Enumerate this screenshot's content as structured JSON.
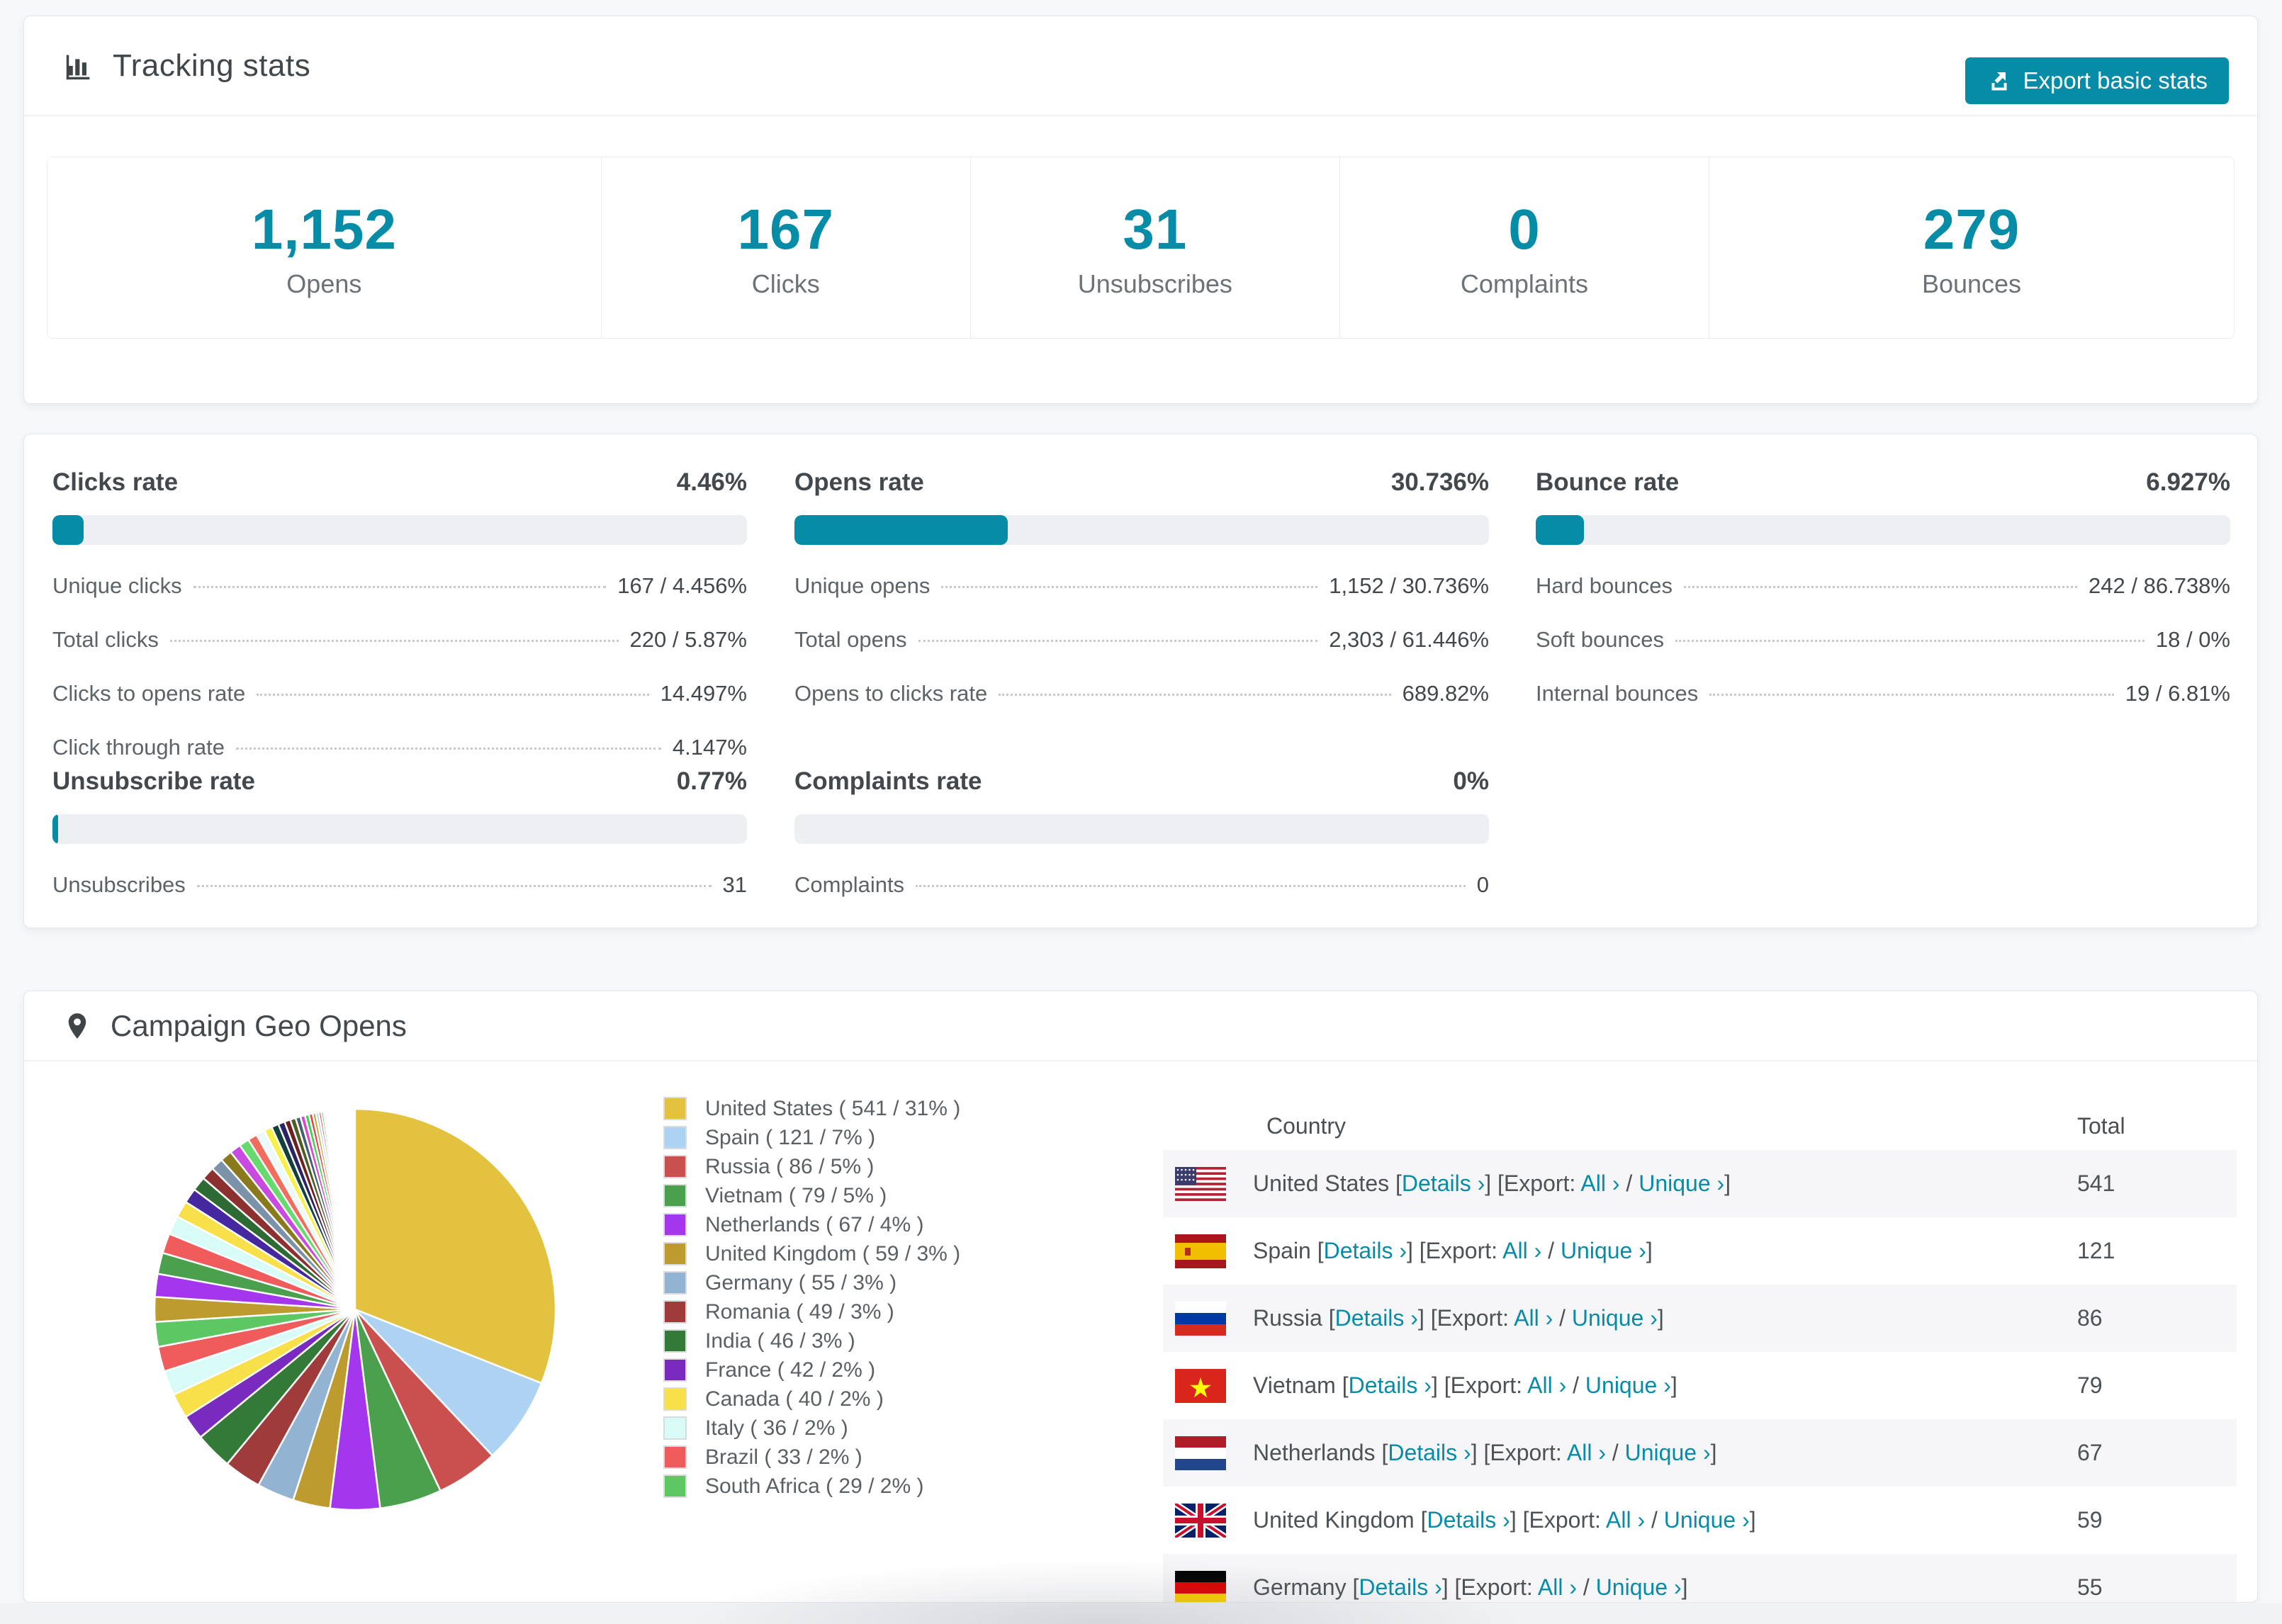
{
  "page": {
    "accent": "#078ca7"
  },
  "tracking": {
    "title": "Tracking stats",
    "export_button": "Export basic stats",
    "summary": [
      {
        "value": "1,152",
        "label": "Opens"
      },
      {
        "value": "167",
        "label": "Clicks"
      },
      {
        "value": "31",
        "label": "Unsubscribes"
      },
      {
        "value": "0",
        "label": "Complaints"
      },
      {
        "value": "279",
        "label": "Bounces"
      }
    ]
  },
  "rates": {
    "clicks": {
      "title": "Clicks rate",
      "value": "4.46%",
      "fill_pct": 4.46,
      "rows": [
        {
          "label": "Unique clicks",
          "value": "167 / 4.456%"
        },
        {
          "label": "Total clicks",
          "value": "220 / 5.87%"
        },
        {
          "label": "Clicks to opens rate",
          "value": "14.497%"
        },
        {
          "label": "Click through rate",
          "value": "4.147%"
        }
      ]
    },
    "opens": {
      "title": "Opens rate",
      "value": "30.736%",
      "fill_pct": 30.736,
      "rows": [
        {
          "label": "Unique opens",
          "value": "1,152 / 30.736%"
        },
        {
          "label": "Total opens",
          "value": "2,303 / 61.446%"
        },
        {
          "label": "Opens to clicks rate",
          "value": "689.82%"
        }
      ]
    },
    "bounce": {
      "title": "Bounce rate",
      "value": "6.927%",
      "fill_pct": 6.927,
      "rows": [
        {
          "label": "Hard bounces",
          "value": "242 / 86.738%"
        },
        {
          "label": "Soft bounces",
          "value": "18 / 0%"
        },
        {
          "label": "Internal bounces",
          "value": "19 / 6.81%"
        }
      ]
    },
    "unsubscribe": {
      "title": "Unsubscribe rate",
      "value": "0.77%",
      "fill_pct": 0.77,
      "rows": [
        {
          "label": "Unsubscribes",
          "value": "31"
        }
      ]
    },
    "complaints": {
      "title": "Complaints rate",
      "value": "0%",
      "fill_pct": 0,
      "rows": [
        {
          "label": "Complaints",
          "value": "0"
        }
      ]
    }
  },
  "geo": {
    "title": "Campaign Geo Opens",
    "table": {
      "headers": {
        "country": "Country",
        "total": "Total"
      },
      "link_labels": {
        "open": "[",
        "close": "]",
        "details": "Details ›",
        "export_prefix": "[Export:",
        "all": "All ›",
        "slash": "/",
        "unique": "Unique ›"
      },
      "rows": [
        {
          "country": "United States",
          "flag": "us",
          "total": "541"
        },
        {
          "country": "Spain",
          "flag": "es",
          "total": "121"
        },
        {
          "country": "Russia",
          "flag": "ru",
          "total": "86"
        },
        {
          "country": "Vietnam",
          "flag": "vn",
          "total": "79"
        },
        {
          "country": "Netherlands",
          "flag": "nl",
          "total": "67"
        },
        {
          "country": "United Kingdom",
          "flag": "gb",
          "total": "59"
        },
        {
          "country": "Germany",
          "flag": "de",
          "total": "55"
        }
      ]
    }
  },
  "chart_data": {
    "type": "pie",
    "title": "Campaign Geo Opens",
    "legend_position": "right",
    "start_angle_deg": 0,
    "direction": "clockwise",
    "legend_format": "{name} ( {value} / {pct}% )",
    "series": [
      {
        "name": "United States",
        "value": 541,
        "pct": 31,
        "color": "#e3c23f"
      },
      {
        "name": "Spain",
        "value": 121,
        "pct": 7,
        "color": "#aed3f2"
      },
      {
        "name": "Russia",
        "value": 86,
        "pct": 5,
        "color": "#c9504f"
      },
      {
        "name": "Vietnam",
        "value": 79,
        "pct": 5,
        "color": "#4ba04e"
      },
      {
        "name": "Netherlands",
        "value": 67,
        "pct": 4,
        "color": "#a437ee"
      },
      {
        "name": "United Kingdom",
        "value": 59,
        "pct": 3,
        "color": "#bd9b2e"
      },
      {
        "name": "Germany",
        "value": 55,
        "pct": 3,
        "color": "#92b4d2"
      },
      {
        "name": "Romania",
        "value": 49,
        "pct": 3,
        "color": "#a03b3b"
      },
      {
        "name": "India",
        "value": 46,
        "pct": 3,
        "color": "#337a38"
      },
      {
        "name": "France",
        "value": 42,
        "pct": 2,
        "color": "#7a2bbf"
      },
      {
        "name": "Canada",
        "value": 40,
        "pct": 2,
        "color": "#f7e04a"
      },
      {
        "name": "Italy",
        "value": 36,
        "pct": 2,
        "color": "#d9fbf7"
      },
      {
        "name": "Brazil",
        "value": 33,
        "pct": 2,
        "color": "#f05c5c"
      },
      {
        "name": "South Africa",
        "value": 29,
        "pct": 2,
        "color": "#5cc763"
      }
    ],
    "other_slices": {
      "note": "unlabeled small countries fanning out counter-clockwise toward 12 o'clock",
      "pcts": [
        2.0,
        1.85,
        1.7,
        1.6,
        1.5,
        1.35,
        1.2,
        1.15,
        1.05,
        1.0,
        0.95,
        0.9,
        0.82,
        0.76,
        0.7,
        0.64,
        0.58,
        0.53,
        0.48,
        0.44,
        0.4,
        0.37,
        0.33,
        0.3,
        0.26,
        0.23,
        0.2,
        0.18,
        0.15,
        0.13,
        0.11,
        0.1,
        0.08,
        0.07
      ],
      "colors": [
        "#bd9b2e",
        "#a437ee",
        "#4ba04e",
        "#f05c5c",
        "#d9fbf7",
        "#f7e04a",
        "#4527a0",
        "#2e6b34",
        "#8d3030",
        "#7b93a8",
        "#8a7a1e",
        "#c84ae0",
        "#66d96f",
        "#f26d5f",
        "#eef9fb",
        "#f5f04a",
        "#12403c",
        "#2b2464",
        "#6e1f1f",
        "#4e5c20",
        "#44606e",
        "#d94ad0",
        "#3fcf5a",
        "#e04545",
        "#c9a22e",
        "#a8d0f0",
        "#d23c3c",
        "#35a04a",
        "#7a2bbf",
        "#e8c547",
        "#f06a6a",
        "#58c8e8",
        "#9a3ce0",
        "#40b060"
      ]
    }
  }
}
